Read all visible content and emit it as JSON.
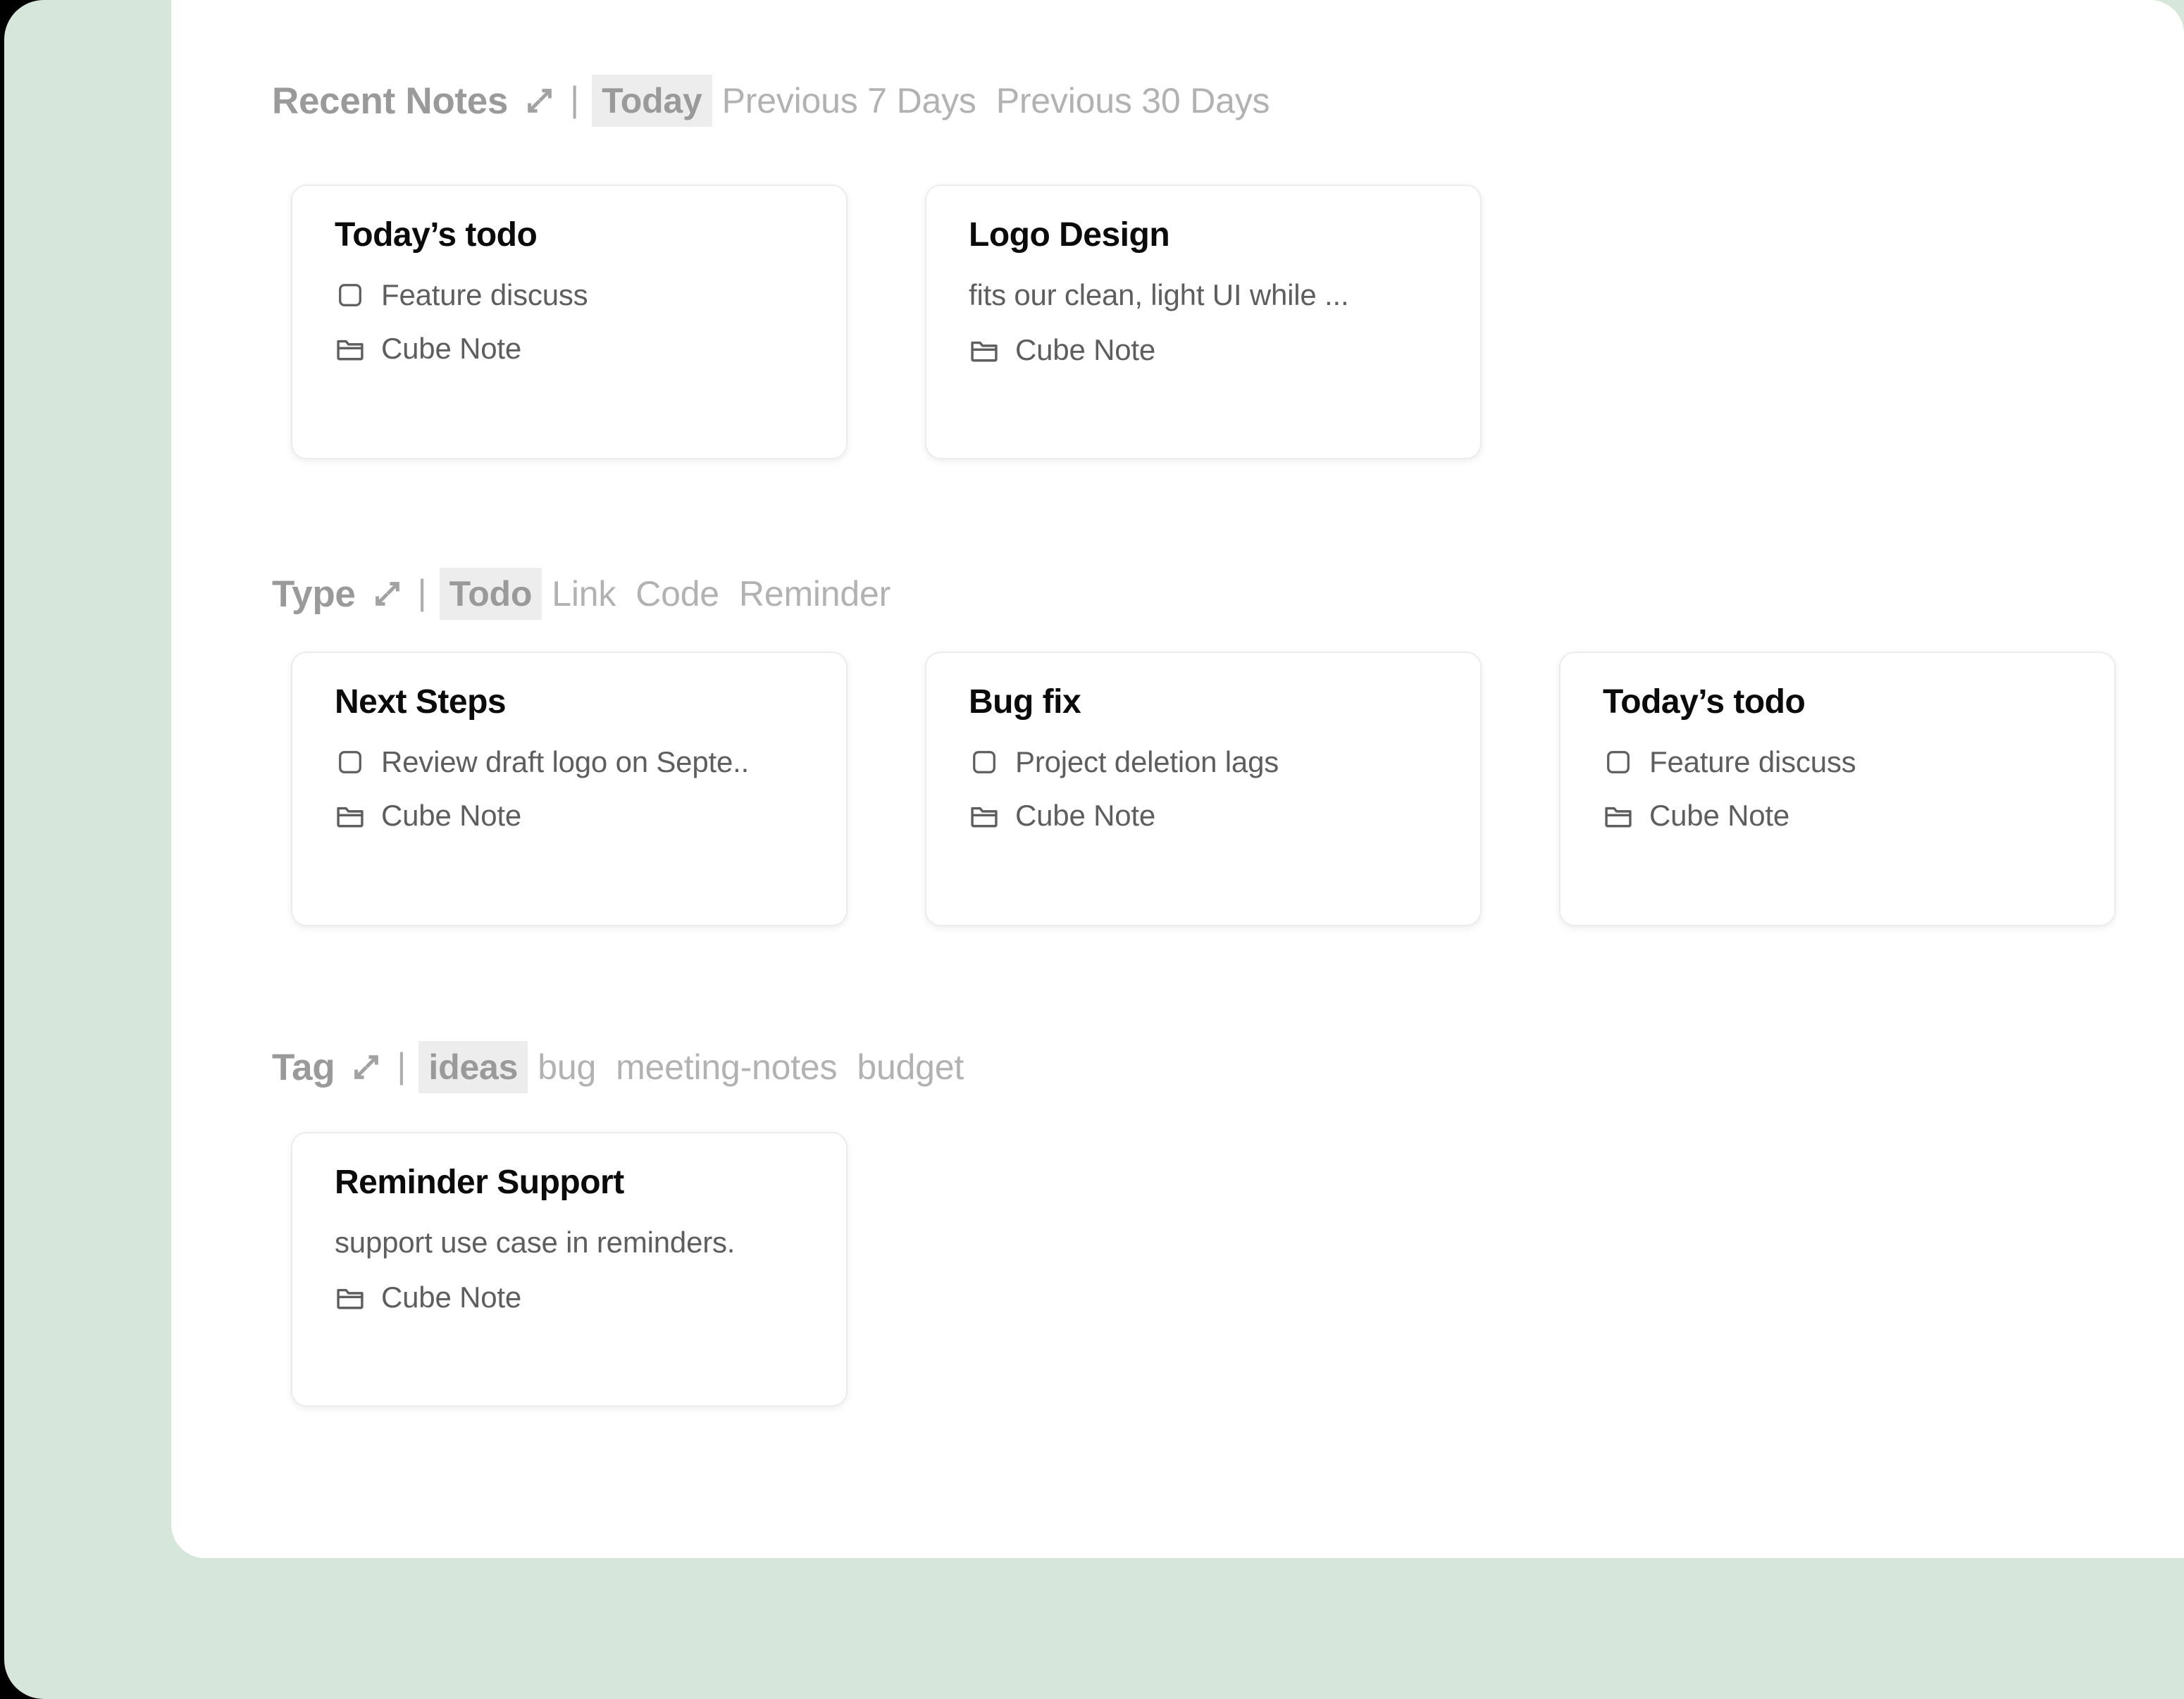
{
  "theme": {
    "background_green": "#d6e6da",
    "panel_white": "#ffffff",
    "selected_pill_bg": "#ededed",
    "muted_text": "#b2b2b2",
    "heading_text": "#9a9a9a",
    "card_border": "#ececec",
    "title_text": "#0b0b0b",
    "body_text": "#5e5e5e"
  },
  "icons": {
    "expand": "expand-diagonal-icon",
    "checkbox": "checkbox-unchecked-icon",
    "folder": "folder-icon"
  },
  "sections": [
    {
      "id": "recent-notes",
      "title": "Recent Notes",
      "expand_icon": "expand-diagonal-icon",
      "separator": "|",
      "filters": [
        {
          "label": "Today",
          "selected": true
        },
        {
          "label": "Previous 7 Days",
          "selected": false
        },
        {
          "label": "Previous 30 Days",
          "selected": false
        }
      ],
      "cards": [
        {
          "title": "Today’s todo",
          "preview": "Feature discuss",
          "preview_icon": "checkbox-unchecked-icon",
          "folder": "Cube Note",
          "folder_icon": "folder-icon"
        },
        {
          "title": "Logo Design",
          "preview": "fits our clean, light UI while ...",
          "preview_icon": null,
          "folder": "Cube Note",
          "folder_icon": "folder-icon"
        }
      ]
    },
    {
      "id": "type",
      "title": "Type",
      "expand_icon": "expand-diagonal-icon",
      "separator": "|",
      "filters": [
        {
          "label": "Todo",
          "selected": true
        },
        {
          "label": "Link",
          "selected": false
        },
        {
          "label": "Code",
          "selected": false
        },
        {
          "label": "Reminder",
          "selected": false
        }
      ],
      "cards": [
        {
          "title": "Next Steps",
          "preview": "Review draft logo on Septe..",
          "preview_icon": "checkbox-unchecked-icon",
          "folder": "Cube Note",
          "folder_icon": "folder-icon"
        },
        {
          "title": "Bug fix",
          "preview": "Project deletion lags",
          "preview_icon": "checkbox-unchecked-icon",
          "folder": "Cube Note",
          "folder_icon": "folder-icon"
        },
        {
          "title": "Today’s todo",
          "preview": "Feature discuss",
          "preview_icon": "checkbox-unchecked-icon",
          "folder": "Cube Note",
          "folder_icon": "folder-icon"
        }
      ]
    },
    {
      "id": "tag",
      "title": "Tag",
      "expand_icon": "expand-diagonal-icon",
      "separator": "|",
      "filters": [
        {
          "label": "ideas",
          "selected": true
        },
        {
          "label": "bug",
          "selected": false
        },
        {
          "label": "meeting-notes",
          "selected": false
        },
        {
          "label": "budget",
          "selected": false
        }
      ],
      "cards": [
        {
          "title": "Reminder Support",
          "preview": "support use case in reminders.",
          "preview_icon": null,
          "folder": "Cube Note",
          "folder_icon": "folder-icon"
        }
      ]
    }
  ]
}
